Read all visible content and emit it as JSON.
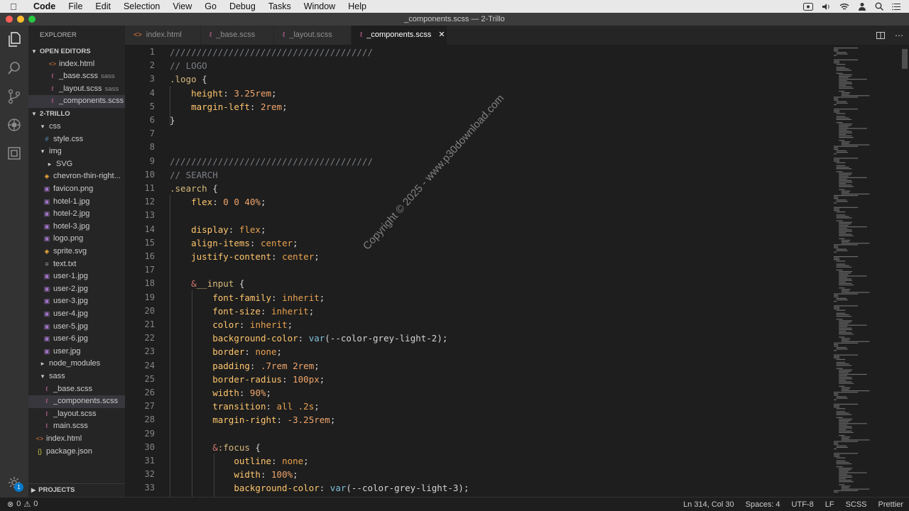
{
  "menubar": {
    "app": "Code",
    "items": [
      "File",
      "Edit",
      "Selection",
      "View",
      "Go",
      "Debug",
      "Tasks",
      "Window",
      "Help"
    ]
  },
  "window": {
    "title": "_components.scss — 2-Trillo"
  },
  "sidebar": {
    "header": "EXPLORER",
    "open_editors_title": "OPEN EDITORS",
    "open_editors": [
      {
        "name": "index.html",
        "type": "html",
        "hint": ""
      },
      {
        "name": "_base.scss",
        "type": "sass",
        "hint": "sass"
      },
      {
        "name": "_layout.scss",
        "type": "sass",
        "hint": "sass"
      },
      {
        "name": "_components.scss",
        "type": "sass",
        "hint": ""
      }
    ],
    "project_title": "2-TRILLO",
    "tree": [
      {
        "name": "css",
        "kind": "folder-open"
      },
      {
        "name": "style.css",
        "kind": "css"
      },
      {
        "name": "img",
        "kind": "folder-open"
      },
      {
        "name": "SVG",
        "kind": "folder-closed"
      },
      {
        "name": "chevron-thin-right...",
        "kind": "svg"
      },
      {
        "name": "favicon.png",
        "kind": "img"
      },
      {
        "name": "hotel-1.jpg",
        "kind": "img"
      },
      {
        "name": "hotel-2.jpg",
        "kind": "img"
      },
      {
        "name": "hotel-3.jpg",
        "kind": "img"
      },
      {
        "name": "logo.png",
        "kind": "img"
      },
      {
        "name": "sprite.svg",
        "kind": "svg"
      },
      {
        "name": "text.txt",
        "kind": "txt"
      },
      {
        "name": "user-1.jpg",
        "kind": "img"
      },
      {
        "name": "user-2.jpg",
        "kind": "img"
      },
      {
        "name": "user-3.jpg",
        "kind": "img"
      },
      {
        "name": "user-4.jpg",
        "kind": "img"
      },
      {
        "name": "user-5.jpg",
        "kind": "img"
      },
      {
        "name": "user-6.jpg",
        "kind": "img"
      },
      {
        "name": "user.jpg",
        "kind": "img"
      },
      {
        "name": "node_modules",
        "kind": "folder-closed"
      },
      {
        "name": "sass",
        "kind": "folder-open"
      },
      {
        "name": "_base.scss",
        "kind": "sass"
      },
      {
        "name": "_components.scss",
        "kind": "sass",
        "selected": true
      },
      {
        "name": "_layout.scss",
        "kind": "sass"
      },
      {
        "name": "main.scss",
        "kind": "sass"
      },
      {
        "name": "index.html",
        "kind": "html"
      },
      {
        "name": "package.json",
        "kind": "json"
      }
    ],
    "projects_title": "PROJECTS"
  },
  "tabs": [
    {
      "label": "index.html",
      "type": "html",
      "active": false
    },
    {
      "label": "_base.scss",
      "type": "sass",
      "active": false
    },
    {
      "label": "_layout.scss",
      "type": "sass",
      "active": false
    },
    {
      "label": "_components.scss",
      "type": "sass",
      "active": true
    }
  ],
  "editor": {
    "lines": [
      {
        "n": "1",
        "tokens": [
          [
            "//////////////////////////////////////",
            "comment"
          ]
        ]
      },
      {
        "n": "2",
        "tokens": [
          [
            "// LOGO",
            "comment"
          ]
        ]
      },
      {
        "n": "3",
        "tokens": [
          [
            ".logo",
            "sel"
          ],
          [
            " {",
            "punc"
          ]
        ]
      },
      {
        "n": "4",
        "tokens": [
          [
            "    ",
            "punc"
          ],
          [
            "height",
            "prop"
          ],
          [
            ": ",
            "punc"
          ],
          [
            "3.25rem",
            "num"
          ],
          [
            ";",
            "punc"
          ]
        ]
      },
      {
        "n": "5",
        "tokens": [
          [
            "    ",
            "punc"
          ],
          [
            "margin-left",
            "prop"
          ],
          [
            ": ",
            "punc"
          ],
          [
            "2rem",
            "num"
          ],
          [
            ";",
            "punc"
          ]
        ]
      },
      {
        "n": "6",
        "tokens": [
          [
            "}",
            "punc"
          ]
        ]
      },
      {
        "n": "7",
        "tokens": []
      },
      {
        "n": "8",
        "tokens": []
      },
      {
        "n": "9",
        "tokens": [
          [
            "//////////////////////////////////////",
            "comment"
          ]
        ]
      },
      {
        "n": "10",
        "tokens": [
          [
            "// SEARCH",
            "comment"
          ]
        ]
      },
      {
        "n": "11",
        "tokens": [
          [
            ".search",
            "sel"
          ],
          [
            " {",
            "punc"
          ]
        ]
      },
      {
        "n": "12",
        "tokens": [
          [
            "    ",
            "punc"
          ],
          [
            "flex",
            "prop"
          ],
          [
            ": ",
            "punc"
          ],
          [
            "0 0 40%",
            "num"
          ],
          [
            ";",
            "punc"
          ]
        ]
      },
      {
        "n": "13",
        "tokens": []
      },
      {
        "n": "14",
        "tokens": [
          [
            "    ",
            "punc"
          ],
          [
            "display",
            "prop"
          ],
          [
            ": ",
            "punc"
          ],
          [
            "flex",
            "val"
          ],
          [
            ";",
            "punc"
          ]
        ]
      },
      {
        "n": "15",
        "tokens": [
          [
            "    ",
            "punc"
          ],
          [
            "align-items",
            "prop"
          ],
          [
            ": ",
            "punc"
          ],
          [
            "center",
            "val"
          ],
          [
            ";",
            "punc"
          ]
        ]
      },
      {
        "n": "16",
        "tokens": [
          [
            "    ",
            "punc"
          ],
          [
            "justify-content",
            "prop"
          ],
          [
            ": ",
            "punc"
          ],
          [
            "center",
            "val"
          ],
          [
            ";",
            "punc"
          ]
        ]
      },
      {
        "n": "17",
        "tokens": []
      },
      {
        "n": "18",
        "tokens": [
          [
            "    ",
            "punc"
          ],
          [
            "&",
            "amp"
          ],
          [
            "__input",
            "sel"
          ],
          [
            " {",
            "punc"
          ]
        ]
      },
      {
        "n": "19",
        "tokens": [
          [
            "        ",
            "punc"
          ],
          [
            "font-family",
            "prop"
          ],
          [
            ": ",
            "punc"
          ],
          [
            "inherit",
            "val"
          ],
          [
            ";",
            "punc"
          ]
        ]
      },
      {
        "n": "20",
        "tokens": [
          [
            "        ",
            "punc"
          ],
          [
            "font-size",
            "prop"
          ],
          [
            ": ",
            "punc"
          ],
          [
            "inherit",
            "val"
          ],
          [
            ";",
            "punc"
          ]
        ]
      },
      {
        "n": "21",
        "tokens": [
          [
            "        ",
            "punc"
          ],
          [
            "color",
            "prop"
          ],
          [
            ": ",
            "punc"
          ],
          [
            "inherit",
            "val"
          ],
          [
            ";",
            "punc"
          ]
        ]
      },
      {
        "n": "22",
        "tokens": [
          [
            "        ",
            "punc"
          ],
          [
            "background-color",
            "prop"
          ],
          [
            ": ",
            "punc"
          ],
          [
            "var",
            "fn"
          ],
          [
            "(--color-grey-light-2)",
            "punc"
          ],
          [
            ";",
            "punc"
          ]
        ]
      },
      {
        "n": "23",
        "tokens": [
          [
            "        ",
            "punc"
          ],
          [
            "border",
            "prop"
          ],
          [
            ": ",
            "punc"
          ],
          [
            "none",
            "val"
          ],
          [
            ";",
            "punc"
          ]
        ]
      },
      {
        "n": "24",
        "tokens": [
          [
            "        ",
            "punc"
          ],
          [
            "padding",
            "prop"
          ],
          [
            ": ",
            "punc"
          ],
          [
            ".7rem 2rem",
            "num"
          ],
          [
            ";",
            "punc"
          ]
        ]
      },
      {
        "n": "25",
        "tokens": [
          [
            "        ",
            "punc"
          ],
          [
            "border-radius",
            "prop"
          ],
          [
            ": ",
            "punc"
          ],
          [
            "100px",
            "num"
          ],
          [
            ";",
            "punc"
          ]
        ]
      },
      {
        "n": "26",
        "tokens": [
          [
            "        ",
            "punc"
          ],
          [
            "width",
            "prop"
          ],
          [
            ": ",
            "punc"
          ],
          [
            "90%",
            "num"
          ],
          [
            ";",
            "punc"
          ]
        ]
      },
      {
        "n": "27",
        "tokens": [
          [
            "        ",
            "punc"
          ],
          [
            "transition",
            "prop"
          ],
          [
            ": ",
            "punc"
          ],
          [
            "all .2s",
            "val"
          ],
          [
            ";",
            "punc"
          ]
        ]
      },
      {
        "n": "28",
        "tokens": [
          [
            "        ",
            "punc"
          ],
          [
            "margin-right",
            "prop"
          ],
          [
            ": ",
            "punc"
          ],
          [
            "-3.25rem",
            "num"
          ],
          [
            ";",
            "punc"
          ]
        ]
      },
      {
        "n": "29",
        "tokens": []
      },
      {
        "n": "30",
        "tokens": [
          [
            "        ",
            "punc"
          ],
          [
            "&",
            "amp"
          ],
          [
            ":focus",
            "sel"
          ],
          [
            " {",
            "punc"
          ]
        ]
      },
      {
        "n": "31",
        "tokens": [
          [
            "            ",
            "punc"
          ],
          [
            "outline",
            "prop"
          ],
          [
            ": ",
            "punc"
          ],
          [
            "none",
            "val"
          ],
          [
            ";",
            "punc"
          ]
        ]
      },
      {
        "n": "32",
        "tokens": [
          [
            "            ",
            "punc"
          ],
          [
            "width",
            "prop"
          ],
          [
            ": ",
            "punc"
          ],
          [
            "100%",
            "num"
          ],
          [
            ";",
            "punc"
          ]
        ]
      },
      {
        "n": "33",
        "tokens": [
          [
            "            ",
            "punc"
          ],
          [
            "background-color",
            "prop"
          ],
          [
            ": ",
            "punc"
          ],
          [
            "var",
            "fn"
          ],
          [
            "(--color-grey-light-3)",
            "punc"
          ],
          [
            ";",
            "punc"
          ]
        ]
      }
    ]
  },
  "watermark": "Copyright © 2025 - www.p30download.com",
  "statusbar": {
    "errors": "0",
    "warnings": "0",
    "position": "Ln 314, Col 30",
    "spaces": "Spaces: 4",
    "encoding": "UTF-8",
    "eol": "LF",
    "language": "SCSS",
    "formatter": "Prettier"
  },
  "activity_badge": "1"
}
